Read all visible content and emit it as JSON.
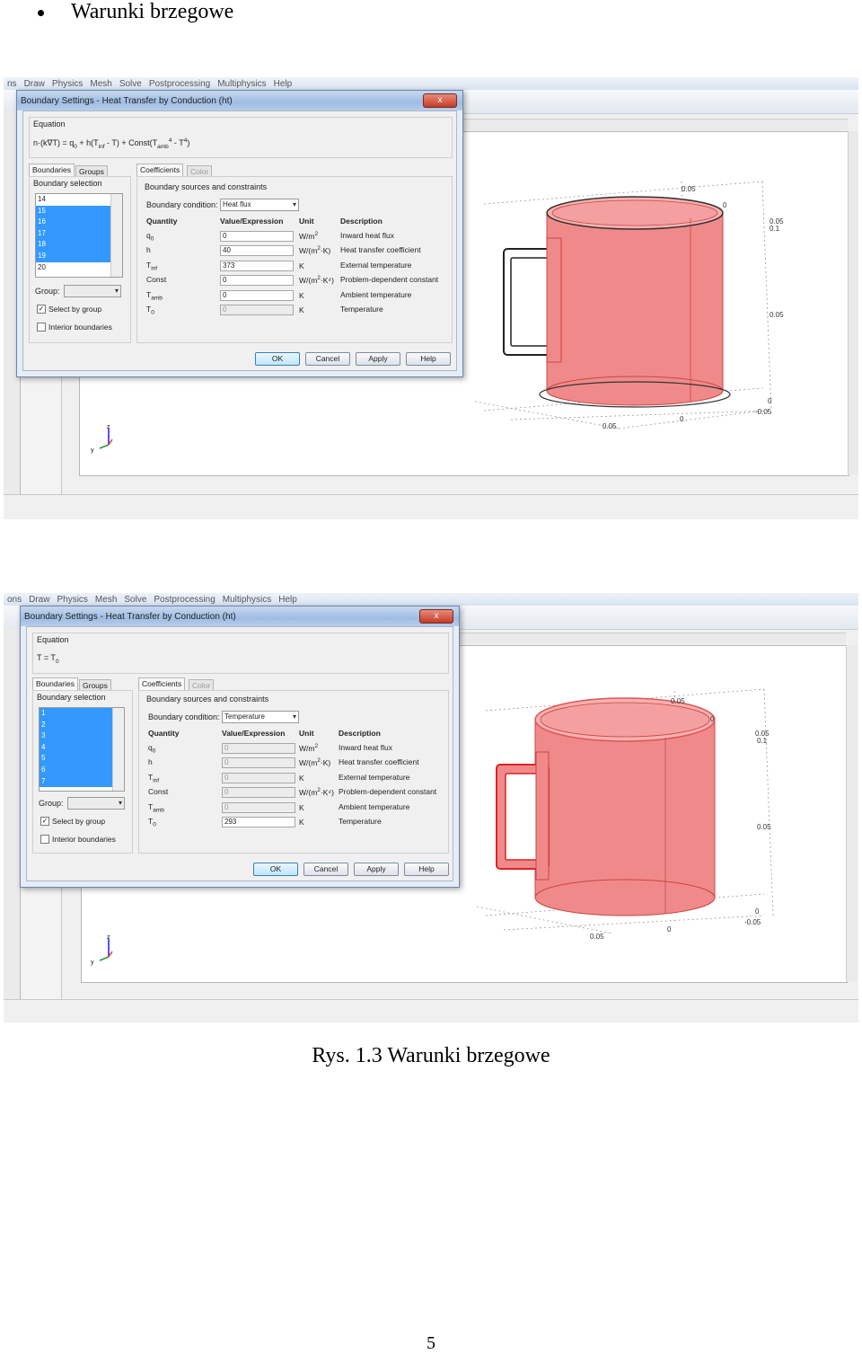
{
  "heading": {
    "text": "Warunki brzegowe"
  },
  "caption": {
    "text": "Rys. 1.3 Warunki brzegowe"
  },
  "page_number": "5",
  "menu_items": [
    "ns",
    "Draw",
    "Physics",
    "Mesh",
    "Solve",
    "Postprocessing",
    "Multiphysics",
    "Help"
  ],
  "menu_items_2": [
    "ons",
    "Draw",
    "Physics",
    "Mesh",
    "Solve",
    "Postprocessing",
    "Multiphysics",
    "Help"
  ],
  "colors": {
    "mug_fill": "#f08a8a",
    "mug_stroke": "#cc4444",
    "selection_blue": "#3399ff"
  },
  "dialog1": {
    "title": "Boundary Settings - Heat Transfer by Conduction (ht)",
    "close": "x",
    "equation_label": "Equation",
    "equation": {
      "lhs": "n·(k∇T) = q",
      "q_sub": "0",
      "mid": " + h(T",
      "tinf_sub": "inf",
      "mid2": " - T) + Const(T",
      "tamb_sub": "amb",
      "pow1": "4",
      "mid3": " - T",
      "pow2": "4",
      "end": ")"
    },
    "tab_boundaries": "Boundaries",
    "tab_groups": "Groups",
    "boundary_selection": "Boundary selection",
    "list": [
      {
        "v": "14",
        "sel": false
      },
      {
        "v": "15",
        "sel": true
      },
      {
        "v": "16",
        "sel": true
      },
      {
        "v": "17",
        "sel": true
      },
      {
        "v": "18",
        "sel": true
      },
      {
        "v": "19",
        "sel": true
      },
      {
        "v": "20",
        "sel": false
      }
    ],
    "group_label": "Group:",
    "select_by_group": "Select by group",
    "interior_boundaries": "Interior boundaries",
    "tab_coefficients": "Coefficients",
    "tab_color": "Color",
    "sources_label": "Boundary sources and constraints",
    "boundary_condition_label": "Boundary condition:",
    "boundary_condition_value": "Heat flux",
    "headers": {
      "quantity": "Quantity",
      "value": "Value/Expression",
      "unit": "Unit",
      "description": "Description"
    },
    "rows": [
      {
        "q": "q",
        "qsub": "0",
        "value": "0",
        "unit": "W/m",
        "usup": "2",
        "unit_end": "",
        "desc": "Inward heat flux",
        "disabled": false
      },
      {
        "q": "h",
        "qsub": "",
        "value": "40",
        "unit": "W/(m",
        "usup": "2",
        "unit_end": "·K)",
        "desc": "Heat transfer coefficient",
        "disabled": false
      },
      {
        "q": "T",
        "qsub": "inf",
        "value": "373",
        "unit": "K",
        "usup": "",
        "unit_end": "",
        "desc": "External temperature",
        "disabled": false
      },
      {
        "q": "Const",
        "qsub": "",
        "value": "0",
        "unit": "W/(m",
        "usup": "2",
        "unit_end": "·K⁴)",
        "desc": "Problem-dependent constant",
        "disabled": false
      },
      {
        "q": "T",
        "qsub": "amb",
        "value": "0",
        "unit": "K",
        "usup": "",
        "unit_end": "",
        "desc": "Ambient temperature",
        "disabled": false
      },
      {
        "q": "T",
        "qsub": "0",
        "value": "0",
        "unit": "K",
        "usup": "",
        "unit_end": "",
        "desc": "Temperature",
        "disabled": true
      }
    ],
    "buttons": {
      "ok": "OK",
      "cancel": "Cancel",
      "apply": "Apply",
      "help": "Help"
    }
  },
  "dialog2": {
    "title": "Boundary Settings - Heat Transfer by Conduction (ht)",
    "close": "x",
    "equation_label": "Equation",
    "equation": {
      "lhs": "T = T",
      "sub": "0"
    },
    "tab_boundaries": "Boundaries",
    "tab_groups": "Groups",
    "boundary_selection": "Boundary selection",
    "list": [
      {
        "v": "1",
        "sel": true
      },
      {
        "v": "2",
        "sel": true
      },
      {
        "v": "3",
        "sel": true
      },
      {
        "v": "4",
        "sel": true
      },
      {
        "v": "5",
        "sel": true
      },
      {
        "v": "6",
        "sel": true
      },
      {
        "v": "7",
        "sel": true
      }
    ],
    "group_label": "Group:",
    "select_by_group": "Select by group",
    "interior_boundaries": "Interior boundaries",
    "tab_coefficients": "Coefficients",
    "tab_color": "Color",
    "sources_label": "Boundary sources and constraints",
    "boundary_condition_label": "Boundary condition:",
    "boundary_condition_value": "Temperature",
    "headers": {
      "quantity": "Quantity",
      "value": "Value/Expression",
      "unit": "Unit",
      "description": "Description"
    },
    "rows": [
      {
        "q": "q",
        "qsub": "0",
        "value": "0",
        "unit": "W/m",
        "usup": "2",
        "unit_end": "",
        "desc": "Inward heat flux",
        "disabled": true
      },
      {
        "q": "h",
        "qsub": "",
        "value": "0",
        "unit": "W/(m",
        "usup": "2",
        "unit_end": "·K)",
        "desc": "Heat transfer coefficient",
        "disabled": true
      },
      {
        "q": "T",
        "qsub": "inf",
        "value": "0",
        "unit": "K",
        "usup": "",
        "unit_end": "",
        "desc": "External temperature",
        "disabled": true
      },
      {
        "q": "Const",
        "qsub": "",
        "value": "0",
        "unit": "W/(m",
        "usup": "2",
        "unit_end": "·K⁴)",
        "desc": "Problem-dependent constant",
        "disabled": true
      },
      {
        "q": "T",
        "qsub": "amb",
        "value": "0",
        "unit": "K",
        "usup": "",
        "unit_end": "",
        "desc": "Ambient temperature",
        "disabled": true
      },
      {
        "q": "T",
        "qsub": "0",
        "value": "293",
        "unit": "K",
        "usup": "",
        "unit_end": "",
        "desc": "Temperature",
        "disabled": false
      }
    ],
    "buttons": {
      "ok": "OK",
      "cancel": "Cancel",
      "apply": "Apply",
      "help": "Help"
    }
  },
  "plot1": {
    "labels": [
      "0.05",
      "0",
      "0.05",
      "0.1",
      "0.05",
      "0",
      "-0.05",
      "0",
      "0.05"
    ],
    "axes": {
      "z": "z",
      "y": "y",
      "x": "x"
    }
  },
  "plot2": {
    "labels": [
      "0.05",
      "0",
      "0.05",
      "0.1",
      "0.05",
      "0",
      "-0.05",
      "0",
      "0.05"
    ],
    "axes": {
      "z": "z",
      "y": "y",
      "x": "x"
    }
  }
}
